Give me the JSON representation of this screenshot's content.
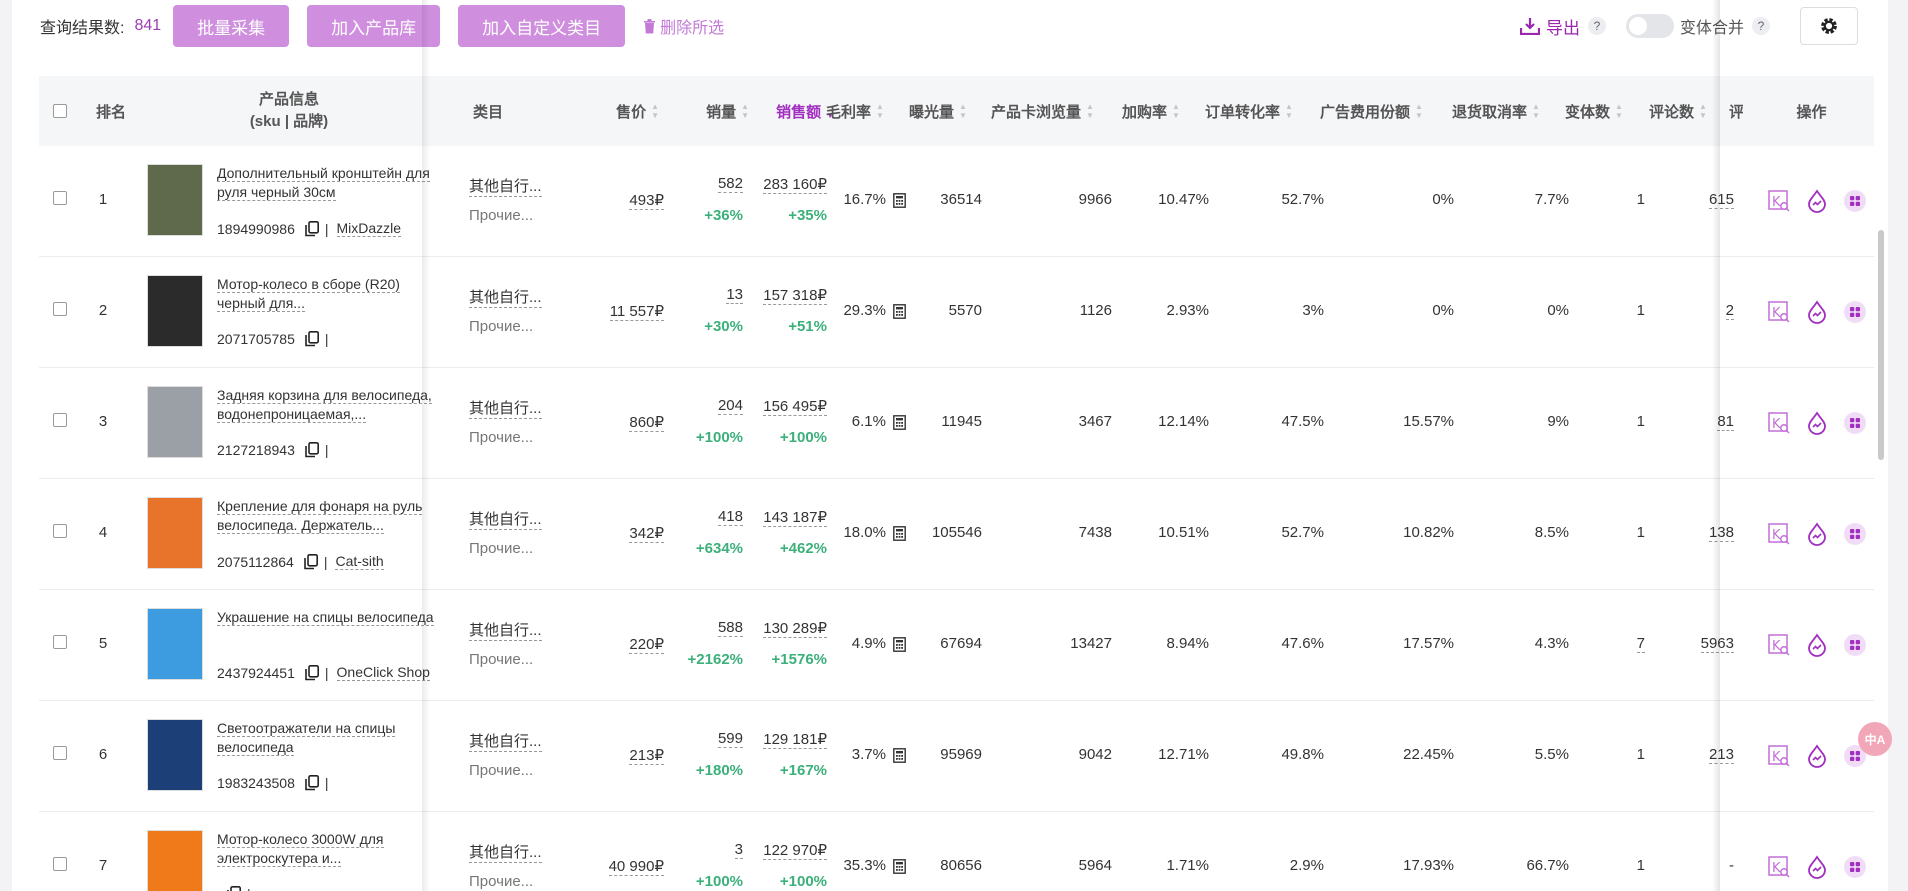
{
  "toolbar": {
    "count_label": "查询结果数:",
    "count_value": "841",
    "btn_batch": "批量采集",
    "btn_add_lib": "加入产品库",
    "btn_add_custom": "加入自定义类目",
    "delete_label": "删除所选",
    "export_label": "导出",
    "help": "?",
    "merge_label": "变体合并"
  },
  "headers": {
    "rank": "排名",
    "product_line1": "产品信息",
    "product_line2": "(sku | 品牌)",
    "category": "类目",
    "price": "售价",
    "sales": "销量",
    "revenue": "销售额",
    "margin": "毛利率",
    "exposure": "曝光量",
    "card_views": "产品卡浏览量",
    "cart_rate": "加购率",
    "conversion": "订单转化率",
    "ad_share": "广告费用份额",
    "return_rate": "退货取消率",
    "variants": "变体数",
    "reviews": "评论数",
    "rating_cut": "评分",
    "actions": "操作"
  },
  "colors": {
    "accent": "#a12fbf",
    "button": "#cf8fde",
    "green": "#3bb07a"
  },
  "rows": [
    {
      "rank": "1",
      "title": "Дополнительный кронштейн для руля черный 30см",
      "sku": "1894990986",
      "brand": "MixDazzle",
      "cat1": "其他自行...",
      "cat2": "Прочие...",
      "price": "493₽",
      "sales": "582",
      "sales_growth": "+36%",
      "revenue": "283 160₽",
      "revenue_growth": "+35%",
      "margin": "16.7%",
      "exposure": "36514",
      "views": "9966",
      "cart": "10.47%",
      "conv": "52.7%",
      "ad": "0%",
      "ret": "7.7%",
      "variants": "1",
      "reviews": "615",
      "thumb": "#5f6a4c"
    },
    {
      "rank": "2",
      "title": "Мотор-колесо в сборе (R20) черный для...",
      "sku": "2071705785",
      "brand": "",
      "cat1": "其他自行...",
      "cat2": "Прочие...",
      "price": "11 557₽",
      "sales": "13",
      "sales_growth": "+30%",
      "revenue": "157 318₽",
      "revenue_growth": "+51%",
      "margin": "29.3%",
      "exposure": "5570",
      "views": "1126",
      "cart": "2.93%",
      "conv": "3%",
      "ad": "0%",
      "ret": "0%",
      "variants": "1",
      "reviews": "2",
      "thumb": "#2b2b2b"
    },
    {
      "rank": "3",
      "title": "Задняя корзина для велосипеда, водонепроницаемая,...",
      "sku": "2127218943",
      "brand": "",
      "cat1": "其他自行...",
      "cat2": "Прочие...",
      "price": "860₽",
      "sales": "204",
      "sales_growth": "+100%",
      "revenue": "156 495₽",
      "revenue_growth": "+100%",
      "margin": "6.1%",
      "exposure": "11945",
      "views": "3467",
      "cart": "12.14%",
      "conv": "47.5%",
      "ad": "15.57%",
      "ret": "9%",
      "variants": "1",
      "reviews": "81",
      "thumb": "#9aa0a6"
    },
    {
      "rank": "4",
      "title": "Крепление для фонаря на руль велосипеда. Держатель...",
      "sku": "2075112864",
      "brand": "Cat-sith",
      "cat1": "其他自行...",
      "cat2": "Прочие...",
      "price": "342₽",
      "sales": "418",
      "sales_growth": "+634%",
      "revenue": "143 187₽",
      "revenue_growth": "+462%",
      "margin": "18.0%",
      "exposure": "105546",
      "views": "7438",
      "cart": "10.51%",
      "conv": "52.7%",
      "ad": "10.82%",
      "ret": "8.5%",
      "variants": "1",
      "reviews": "138",
      "thumb": "#e8732a"
    },
    {
      "rank": "5",
      "title": "Украшение на спицы велосипеда",
      "sku": "2437924451",
      "brand": "OneClick Shop",
      "cat1": "其他自行...",
      "cat2": "Прочие...",
      "price": "220₽",
      "sales": "588",
      "sales_growth": "+2162%",
      "revenue": "130 289₽",
      "revenue_growth": "+1576%",
      "margin": "4.9%",
      "exposure": "67694",
      "views": "13427",
      "cart": "8.94%",
      "conv": "47.6%",
      "ad": "17.57%",
      "ret": "4.3%",
      "variants": "7",
      "reviews": "5963",
      "thumb": "#3d9be0"
    },
    {
      "rank": "6",
      "title": "Светоотражатели на спицы велосипеда",
      "sku": "1983243508",
      "brand": "",
      "cat1": "其他自行...",
      "cat2": "Прочие...",
      "price": "213₽",
      "sales": "599",
      "sales_growth": "+180%",
      "revenue": "129 181₽",
      "revenue_growth": "+167%",
      "margin": "3.7%",
      "exposure": "95969",
      "views": "9042",
      "cart": "12.71%",
      "conv": "49.8%",
      "ad": "22.45%",
      "ret": "5.5%",
      "variants": "1",
      "reviews": "213",
      "thumb": "#1d3f78"
    },
    {
      "rank": "7",
      "title": "Мотор-колесо 3000W для электроскутера и...",
      "sku": "",
      "brand": "",
      "cat1": "其他自行...",
      "cat2": "Прочие...",
      "price": "40 990₽",
      "sales": "3",
      "sales_growth": "+100%",
      "revenue": "122 970₽",
      "revenue_growth": "+100%",
      "margin": "35.3%",
      "exposure": "80656",
      "views": "5964",
      "cart": "1.71%",
      "conv": "2.9%",
      "ad": "17.93%",
      "ret": "66.7%",
      "variants": "1",
      "reviews": "-",
      "thumb": "#f07a1a"
    }
  ],
  "float_badge": "中A"
}
